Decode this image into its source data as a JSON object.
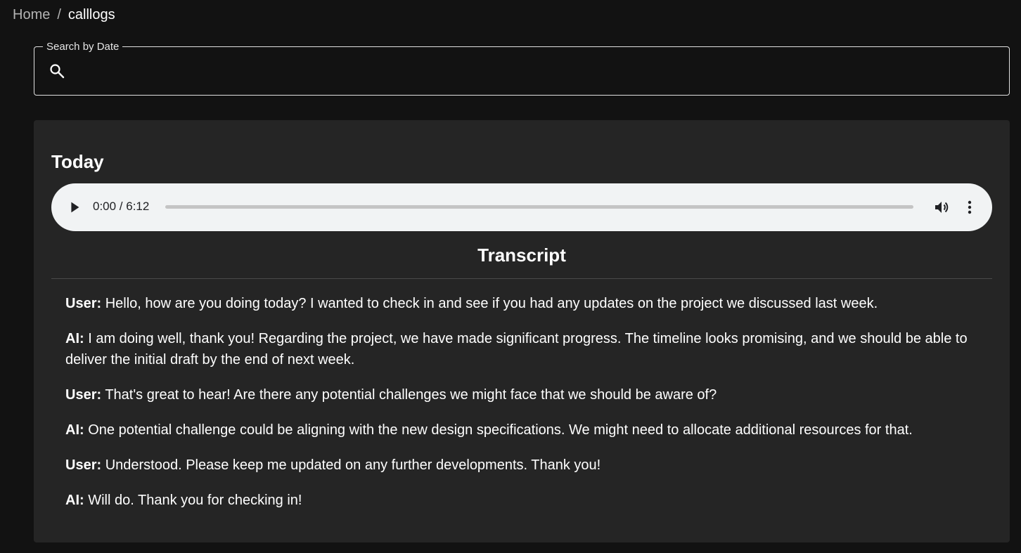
{
  "breadcrumb": {
    "home": "Home",
    "separator": "/",
    "current": "calllogs"
  },
  "search": {
    "label": "Search by Date",
    "value": "",
    "placeholder": "",
    "icon": "search-icon"
  },
  "calllog": {
    "date_label": "Today",
    "audio": {
      "time_display": "0:00 / 6:12",
      "progress": 0,
      "icons": [
        "play-icon",
        "volume-icon",
        "more-vertical-icon"
      ]
    },
    "transcript_title": "Transcript",
    "transcript": [
      {
        "speaker": "User:",
        "text": " Hello, how are you doing today? I wanted to check in and see if you had any updates on the project we discussed last week."
      },
      {
        "speaker": "AI:",
        "text": " I am doing well, thank you! Regarding the project, we have made significant progress. The timeline looks promising, and we should be able to deliver the initial draft by the end of next week."
      },
      {
        "speaker": "User:",
        "text": " That's great to hear! Are there any potential challenges we might face that we should be aware of?"
      },
      {
        "speaker": "AI:",
        "text": " One potential challenge could be aligning with the new design specifications. We might need to allocate additional resources for that."
      },
      {
        "speaker": "User:",
        "text": " Understood. Please keep me updated on any further developments. Thank you!"
      },
      {
        "speaker": "AI:",
        "text": " Will do. Thank you for checking in!"
      }
    ]
  },
  "colors": {
    "background": "#121212",
    "card": "#252525",
    "player": "#f1f3f4",
    "text": "#ffffff",
    "muted": "#b3b3b3"
  }
}
